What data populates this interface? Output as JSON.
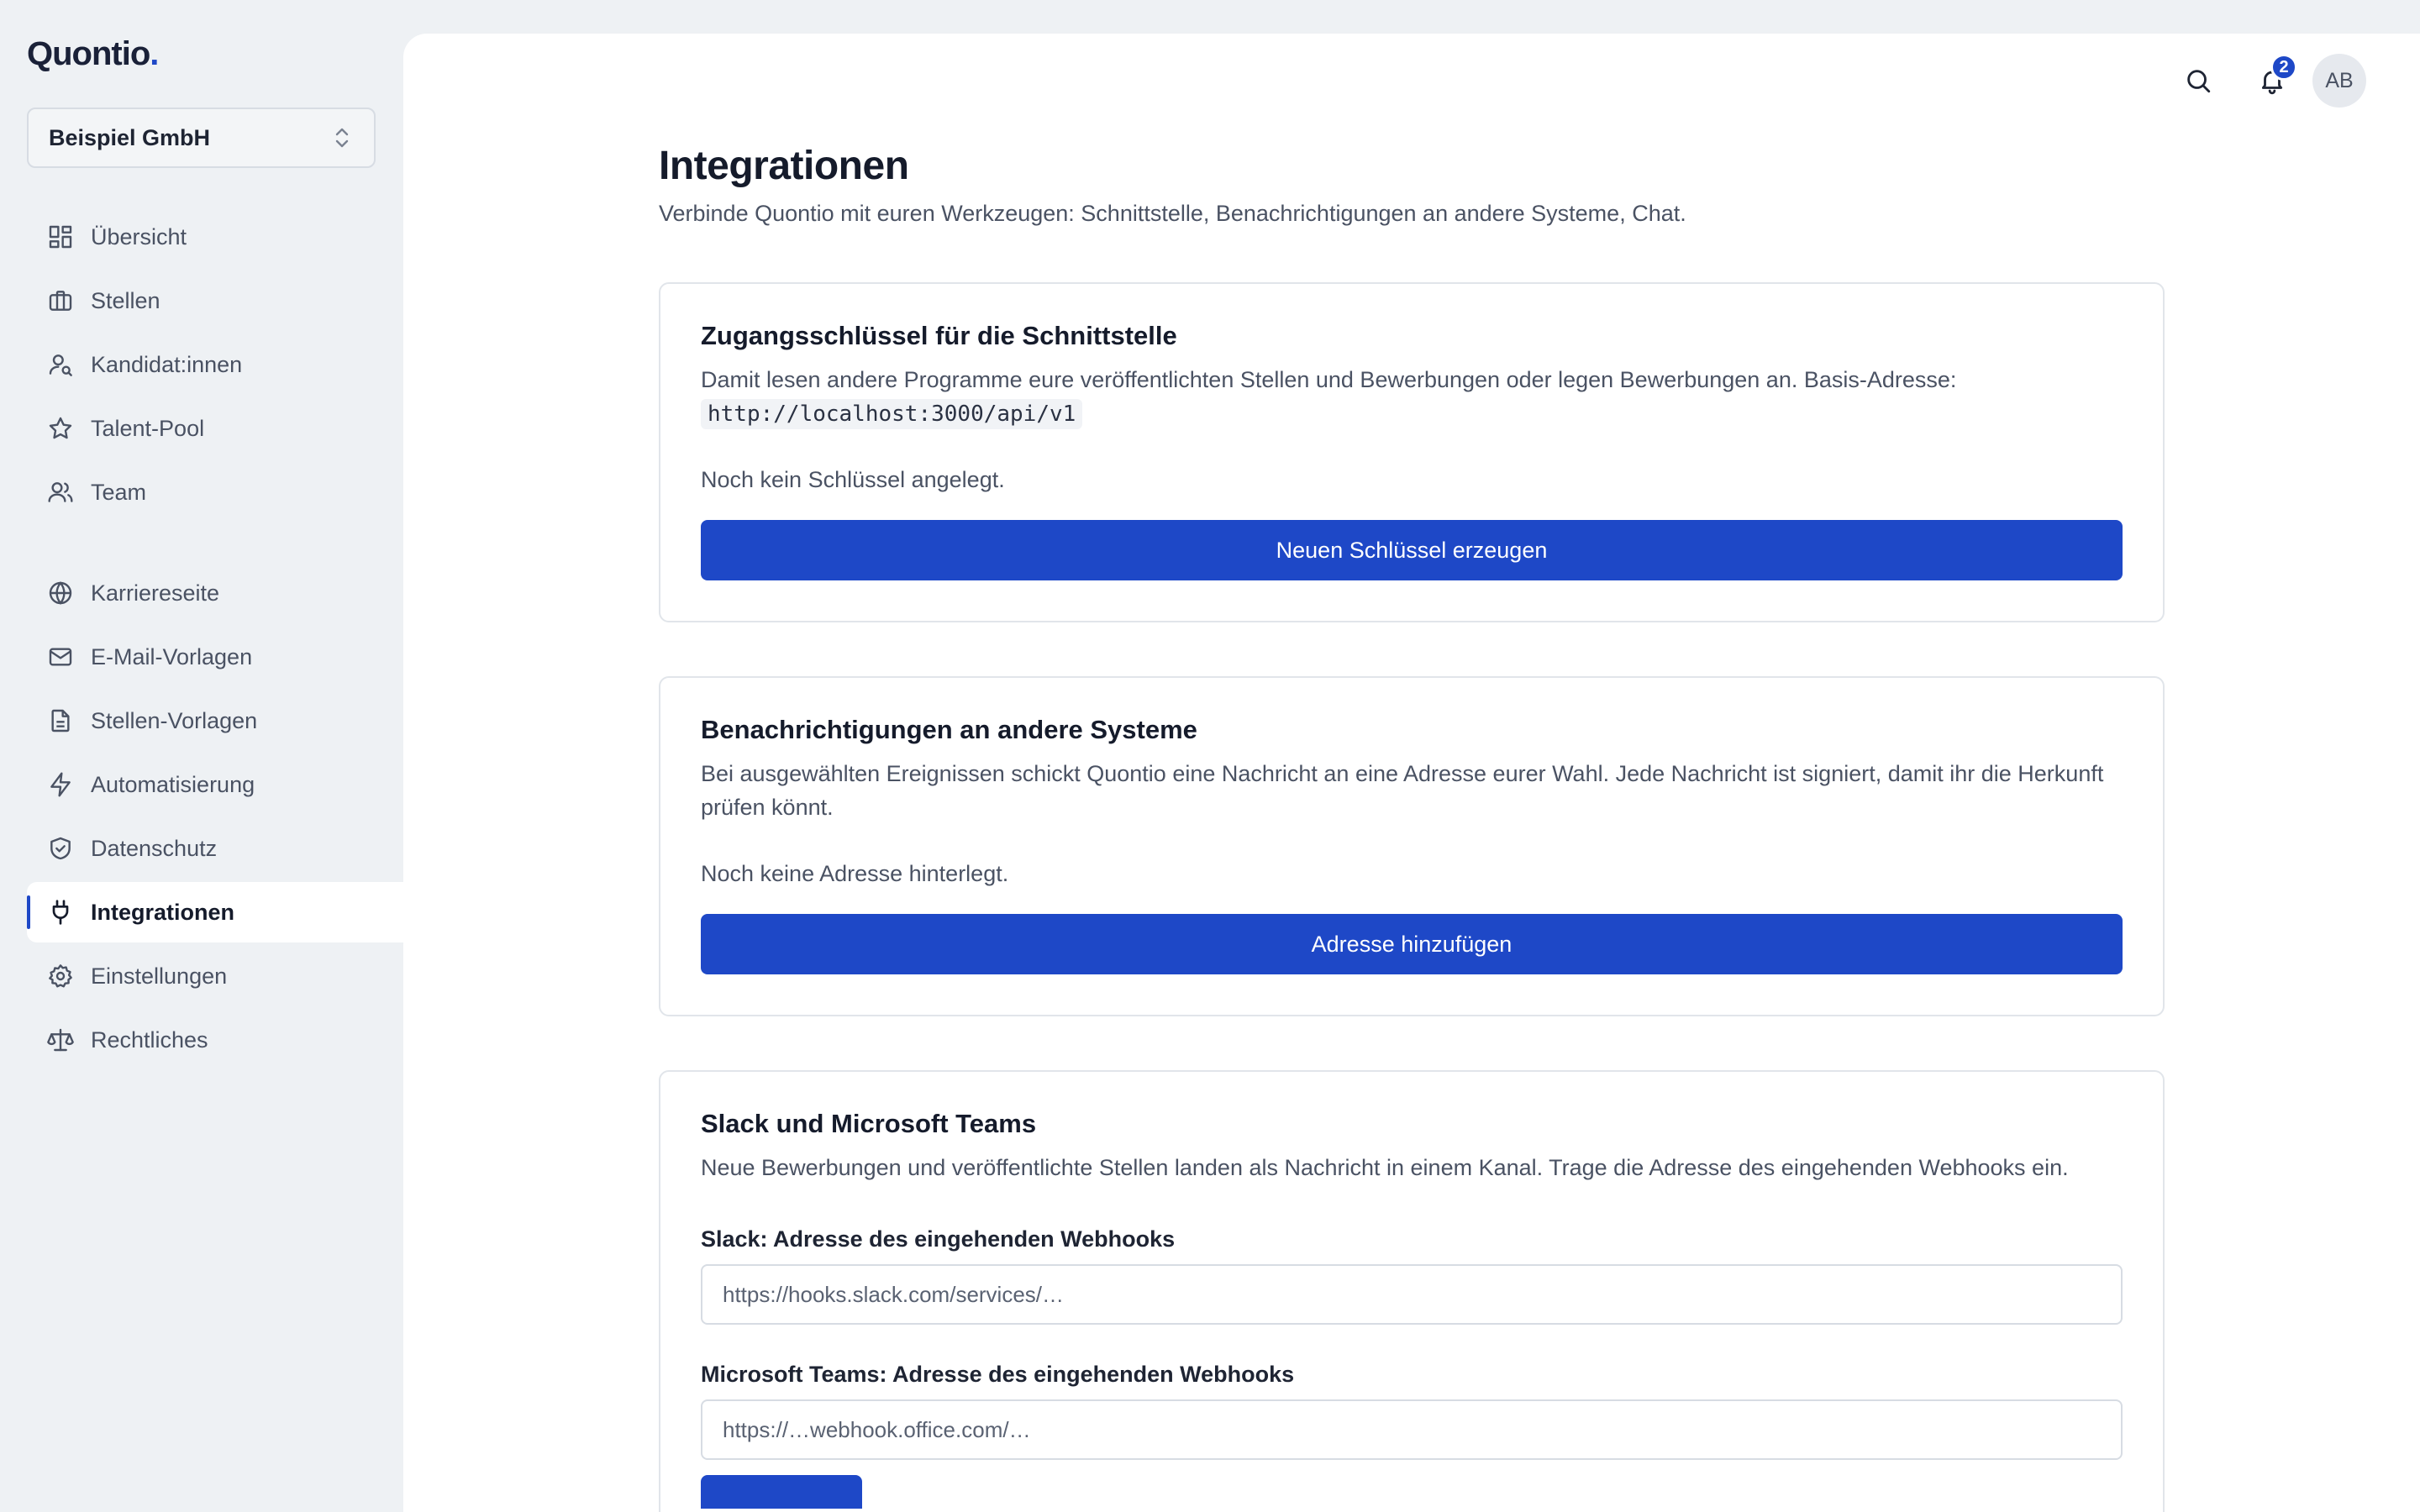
{
  "brand": {
    "name": "Quontio",
    "dot": "."
  },
  "org": {
    "selected": "Beispiel GmbH"
  },
  "sidebar": {
    "primary": [
      {
        "label": "Übersicht",
        "icon": "dashboard-icon"
      },
      {
        "label": "Stellen",
        "icon": "briefcase-icon"
      },
      {
        "label": "Kandidat:innen",
        "icon": "user-search-icon"
      },
      {
        "label": "Talent-Pool",
        "icon": "star-icon"
      },
      {
        "label": "Team",
        "icon": "users-icon"
      }
    ],
    "secondary": [
      {
        "label": "Karriereseite",
        "icon": "globe-icon"
      },
      {
        "label": "E-Mail-Vorlagen",
        "icon": "mail-icon"
      },
      {
        "label": "Stellen-Vorlagen",
        "icon": "file-text-icon"
      },
      {
        "label": "Automatisierung",
        "icon": "zap-icon"
      },
      {
        "label": "Datenschutz",
        "icon": "shield-check-icon"
      },
      {
        "label": "Integrationen",
        "icon": "plug-icon",
        "active": true
      },
      {
        "label": "Einstellungen",
        "icon": "gear-icon"
      },
      {
        "label": "Rechtliches",
        "icon": "scale-icon"
      }
    ]
  },
  "topbar": {
    "notifications_count": "2",
    "avatar_initials": "AB"
  },
  "page": {
    "title": "Integrationen",
    "subtitle": "Verbinde Quontio mit euren Werkzeugen: Schnittstelle, Benachrichtigungen an andere Systeme, Chat."
  },
  "api_card": {
    "title": "Zugangsschlüssel für die Schnittstelle",
    "description": "Damit lesen andere Programme eure veröffentlichten Stellen und Bewerbungen oder legen Bewerbungen an. Basis-Adresse:",
    "base_url": "http://localhost:3000/api/v1",
    "empty_state": "Noch kein Schlüssel angelegt.",
    "button": "Neuen Schlüssel erzeugen"
  },
  "webhook_card": {
    "title": "Benachrichtigungen an andere Systeme",
    "description": "Bei ausgewählten Ereignissen schickt Quontio eine Nachricht an eine Adresse eurer Wahl. Jede Nachricht ist signiert, damit ihr die Herkunft prüfen könnt.",
    "empty_state": "Noch keine Adresse hinterlegt.",
    "button": "Adresse hinzufügen"
  },
  "chat_card": {
    "title": "Slack und Microsoft Teams",
    "description": "Neue Bewerbungen und veröffentlichte Stellen landen als Nachricht in einem Kanal. Trage die Adresse des eingehenden Webhooks ein.",
    "slack_label": "Slack: Adresse des eingehenden Webhooks",
    "slack_placeholder": "https://hooks.slack.com/services/…",
    "teams_label": "Microsoft Teams: Adresse des eingehenden Webhooks",
    "teams_placeholder": "https://…webhook.office.com/…"
  },
  "colors": {
    "accent": "#1e48c7",
    "sidebar_bg": "#eef1f4",
    "panel_bg": "#ffffff",
    "text_muted": "#4a5263"
  }
}
